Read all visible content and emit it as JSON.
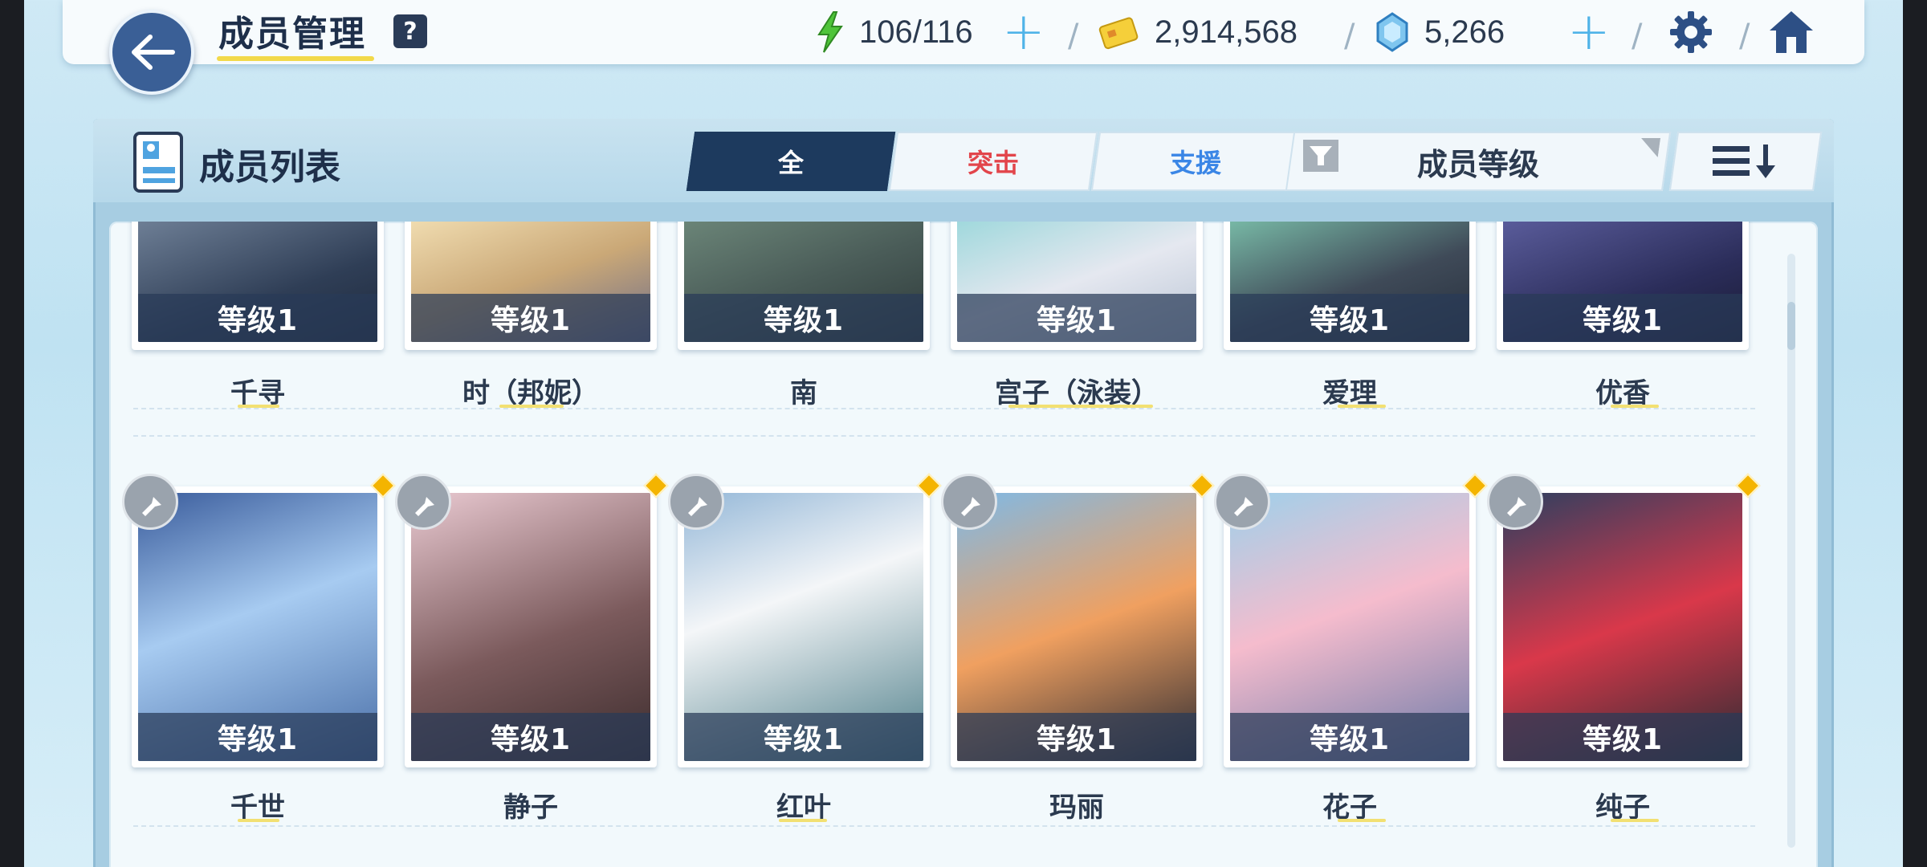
{
  "header": {
    "title": "成员管理",
    "help_label": "?",
    "ap": "106/116",
    "credits": "2,914,568",
    "gems": "5,266",
    "plus": "+"
  },
  "panel": {
    "title": "成员列表",
    "tabs": [
      {
        "label": "全",
        "state": "active"
      },
      {
        "label": "突击",
        "color": "#e2454b"
      },
      {
        "label": "支援",
        "color": "#3a86e6"
      }
    ],
    "sort_label": "成员等级"
  },
  "row1": [
    {
      "level": "等级1",
      "name": "千寻"
    },
    {
      "level": "等级1",
      "name": "时（邦妮）"
    },
    {
      "level": "等级1",
      "name": "南"
    },
    {
      "level": "等级1",
      "name": "宫子（泳装）"
    },
    {
      "level": "等级1",
      "name": "爱理"
    },
    {
      "level": "等级1",
      "name": "优香"
    }
  ],
  "row2": [
    {
      "level": "等级1",
      "name": "千世"
    },
    {
      "level": "等级1",
      "name": "静子"
    },
    {
      "level": "等级1",
      "name": "红叶"
    },
    {
      "level": "等级1",
      "name": "玛丽"
    },
    {
      "level": "等级1",
      "name": "花子"
    },
    {
      "level": "等级1",
      "name": "纯子"
    }
  ],
  "colors": {
    "accent_dark": "#1d3a5e",
    "striker_red": "#e2454b",
    "special_blue": "#3a86e6",
    "new_marker": "#f4b400"
  }
}
